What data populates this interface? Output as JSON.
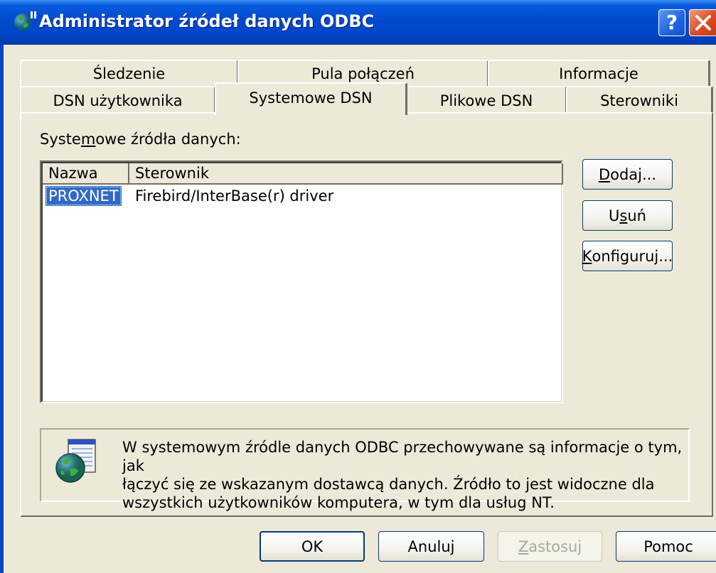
{
  "window": {
    "title": "Administrator źródeł danych ODBC",
    "help_label": "?"
  },
  "tabs": {
    "row_back": [
      {
        "label": "Śledzenie"
      },
      {
        "label": "Pula połączeń"
      },
      {
        "label": "Informacje"
      }
    ],
    "row_front": [
      {
        "label": "DSN użytkownika"
      },
      {
        "label": "Systemowe DSN",
        "active": true
      },
      {
        "label": "Plikowe DSN"
      },
      {
        "label": "Sterowniki"
      }
    ]
  },
  "panel": {
    "list_label_before": "Syste",
    "list_label_underline": "m",
    "list_label_after": "owe źródła danych:",
    "columns": [
      {
        "label": "Nazwa"
      },
      {
        "label": "Sterownik"
      }
    ],
    "rows": [
      {
        "name": "PROXNET",
        "driver": "Firebird/InterBase(r) driver",
        "selected": true
      }
    ],
    "buttons": {
      "add": {
        "pre": "",
        "u": "D",
        "post": "odaj..."
      },
      "remove": {
        "pre": "U",
        "u": "s",
        "post": "uń"
      },
      "configure": {
        "pre": "",
        "u": "K",
        "post": "onfiguruj..."
      }
    },
    "info_lines": [
      "W systemowym źródle danych ODBC przechowywane są informacje o tym, jak",
      "łączyć się ze wskazanym dostawcą danych. Źródło to jest widoczne dla",
      "wszystkich użytkowników komputera, w tym dla usług NT."
    ]
  },
  "footer": {
    "ok": "OK",
    "cancel": "Anuluj",
    "apply_pre": "",
    "apply_u": "Z",
    "apply_post": "astosuj",
    "help": "Pomoc"
  }
}
